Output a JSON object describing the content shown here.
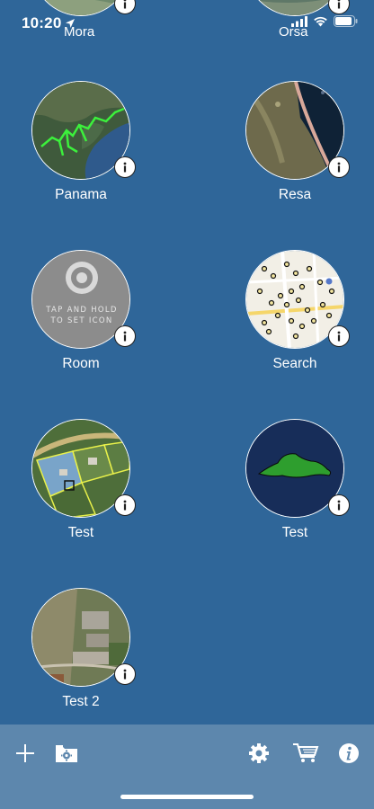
{
  "status_bar": {
    "time": "10:20",
    "icons": [
      "location-arrow-icon",
      "signal-icon",
      "wifi-icon",
      "battery-icon"
    ]
  },
  "colors": {
    "background": "#2f6699",
    "toolbar": "#5d87ad",
    "tile_border": "#ffffff"
  },
  "partial_tiles": [
    {
      "label": "Mora"
    },
    {
      "label": "Orsa"
    }
  ],
  "tiles": [
    {
      "label": "Panama",
      "thumbnail": "satellite-map-with-green-track"
    },
    {
      "label": "Resa",
      "thumbnail": "satellite-map-road-by-water"
    },
    {
      "label": "Room",
      "thumbnail": "placeholder-target-icon",
      "placeholder_text": "TAP AND HOLD TO SET ICON"
    },
    {
      "label": "Search",
      "thumbnail": "street-map-with-markers"
    },
    {
      "label": "Test",
      "thumbnail": "aerial-parcels-map"
    },
    {
      "label": "Test",
      "thumbnail": "green-polygon-on-navy"
    },
    {
      "label": "Test 2",
      "thumbnail": "aerial-farm-buildings"
    }
  ],
  "toolbar": {
    "items": [
      "add-icon",
      "folder-gear-icon",
      "settings-icon",
      "cart-icon",
      "info-icon"
    ]
  }
}
